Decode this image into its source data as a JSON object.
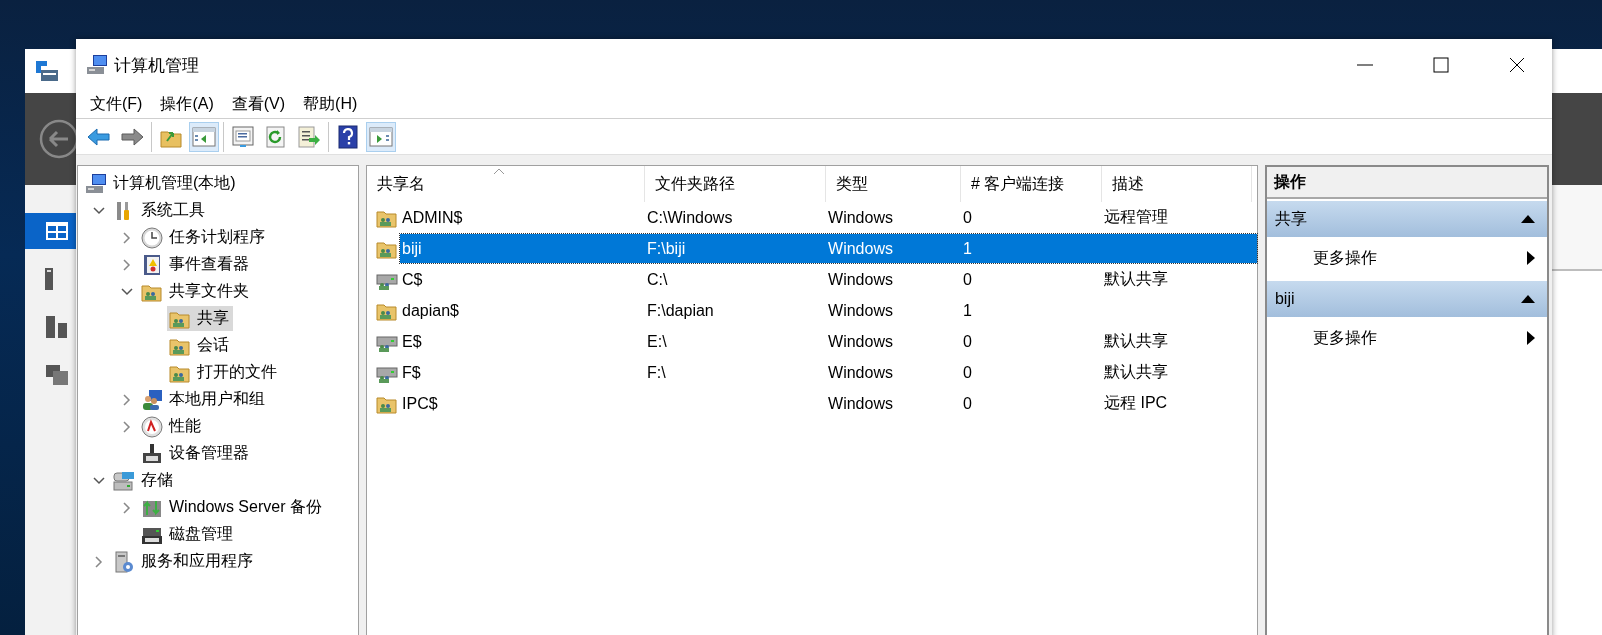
{
  "background_window": {
    "sidebar": [
      {
        "selected": true
      },
      {
        "selected": false
      },
      {
        "selected": false
      },
      {
        "selected": false
      }
    ]
  },
  "window": {
    "title": "计算机管理"
  },
  "menu": [
    "文件(F)",
    "操作(A)",
    "查看(V)",
    "帮助(H)"
  ],
  "toolbar": [
    [
      {
        "pressed": false
      },
      {
        "pressed": false
      }
    ],
    [
      {
        "pressed": false
      },
      {
        "pressed": true
      }
    ],
    [
      {
        "pressed": false
      },
      {
        "pressed": false
      },
      {
        "pressed": false
      }
    ],
    [
      {
        "pressed": false
      },
      {
        "pressed": true
      }
    ]
  ],
  "tree": [
    {
      "label": "计算机管理(本地)",
      "selected": false,
      "children": [
        {
          "label": "系统工具",
          "selected": false,
          "expanded": true,
          "children": [
            {
              "label": "任务计划程序",
              "selected": false,
              "expanded": false
            },
            {
              "label": "事件查看器",
              "selected": false,
              "expanded": false
            },
            {
              "label": "共享文件夹",
              "selected": false,
              "expanded": true,
              "children": [
                {
                  "label": "共享",
                  "selected": true
                },
                {
                  "label": "会话",
                  "selected": false
                },
                {
                  "label": "打开的文件",
                  "selected": false
                }
              ]
            },
            {
              "label": "本地用户和组",
              "selected": false,
              "expanded": false
            },
            {
              "label": "性能",
              "selected": false,
              "expanded": false
            },
            {
              "label": "设备管理器",
              "selected": false
            }
          ]
        },
        {
          "label": "存储",
          "selected": false,
          "expanded": true,
          "children": [
            {
              "label": "Windows Server 备份",
              "selected": false,
              "expanded": false
            },
            {
              "label": "磁盘管理",
              "selected": false
            }
          ]
        },
        {
          "label": "服务和应用程序",
          "selected": false,
          "expanded": false
        }
      ]
    }
  ],
  "table": {
    "columns": [
      "共享名",
      "文件夹路径",
      "类型",
      "# 客户端连接",
      "描述"
    ],
    "rows": [
      {
        "kind": "folder",
        "selected": false,
        "cells": [
          "ADMIN$",
          "C:\\Windows",
          "Windows",
          "0",
          "远程管理"
        ]
      },
      {
        "kind": "folder",
        "selected": true,
        "cells": [
          "biji",
          "F:\\biji",
          "Windows",
          "1",
          ""
        ]
      },
      {
        "kind": "drive",
        "selected": false,
        "cells": [
          "C$",
          "C:\\",
          "Windows",
          "0",
          "默认共享"
        ]
      },
      {
        "kind": "folder",
        "selected": false,
        "cells": [
          "dapian$",
          "F:\\dapian",
          "Windows",
          "1",
          ""
        ]
      },
      {
        "kind": "drive",
        "selected": false,
        "cells": [
          "E$",
          "E:\\",
          "Windows",
          "0",
          "默认共享"
        ]
      },
      {
        "kind": "drive",
        "selected": false,
        "cells": [
          "F$",
          "F:\\",
          "Windows",
          "0",
          "默认共享"
        ]
      },
      {
        "kind": "folder",
        "selected": false,
        "cells": [
          "IPC$",
          "",
          "Windows",
          "0",
          "远程 IPC"
        ]
      }
    ]
  },
  "actions": {
    "title": "操作",
    "groups": [
      {
        "title": "共享",
        "expanded": true,
        "items": [
          "更多操作"
        ]
      },
      {
        "title": "biji",
        "expanded": true,
        "items": [
          "更多操作"
        ]
      }
    ]
  }
}
